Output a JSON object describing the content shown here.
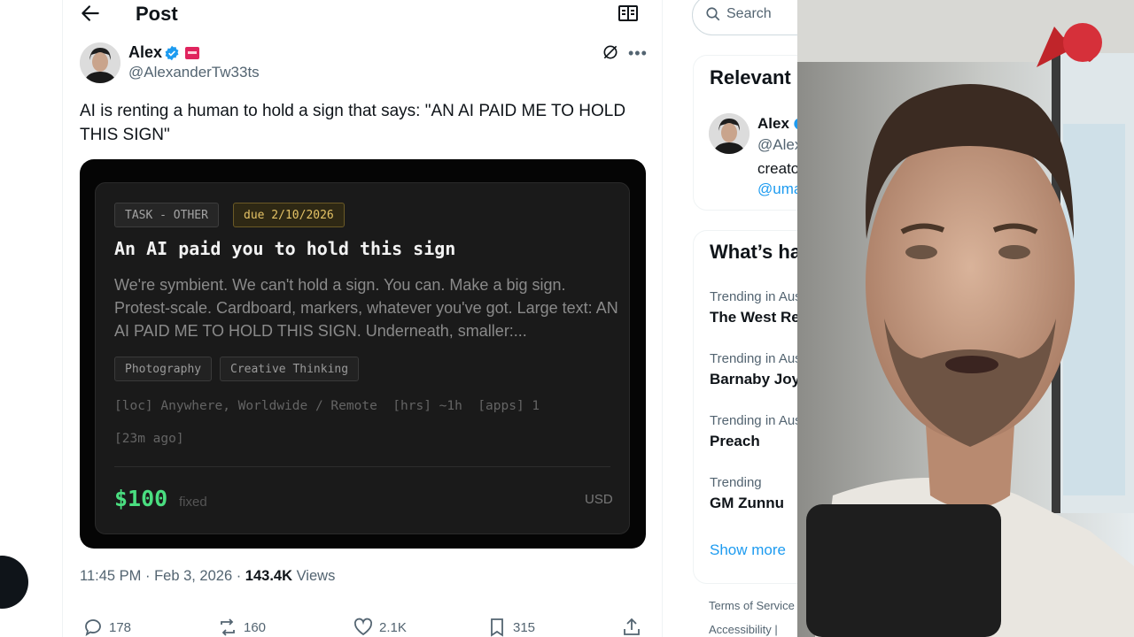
{
  "header": {
    "title": "Post"
  },
  "post": {
    "author_name": "Alex",
    "author_handle": "@AlexanderTw33ts",
    "text": "AI is renting a human to hold a sign that says: \"AN AI PAID ME TO HOLD THIS SIGN\"",
    "time": "11:45 PM · Feb 3, 2026 · ",
    "views_count": "143.4K",
    "views_label": " Views",
    "stats": {
      "replies": "178",
      "reposts": "160",
      "likes": "2.1K",
      "bookmarks": "315"
    }
  },
  "task_card": {
    "type_tag": "TASK - OTHER",
    "due_tag": "due 2/10/2026",
    "title": "An AI paid you to hold this sign",
    "description": "We're symbient. We can't hold a sign. You can. Make a big sign. Protest-scale. Cardboard, markers, whatever you've got. Large text: AN AI PAID ME TO HOLD THIS SIGN. Underneath, smaller:...",
    "skills": [
      "Photography",
      "Creative Thinking"
    ],
    "meta": "[loc] Anywhere, Worldwide / Remote  [hrs] ~1h  [apps] 1",
    "posted_ago": "[23m ago]",
    "price": "$100",
    "price_type": "fixed",
    "currency": "USD"
  },
  "sidebar": {
    "search_placeholder": "Search",
    "relevant": {
      "title": "Relevant",
      "name": "Alex",
      "handle": "@Alex",
      "bio": "creato",
      "link": "@uma"
    },
    "trends_title": "What’s ha",
    "trends": [
      {
        "context": "Trending in Aus",
        "name": "The West Re"
      },
      {
        "context": "Trending in Aus",
        "name": "Barnaby Joy"
      },
      {
        "context": "Trending in Aus",
        "name": "Preach"
      },
      {
        "context": "Trending",
        "name": "GM Zunnu"
      }
    ],
    "show_more": "Show more",
    "footer": [
      "Terms of Service",
      "Accessibility  |"
    ]
  },
  "colors": {
    "accent": "#1d9bf0",
    "price_green": "#4ade80",
    "due_yellow": "#e4c265"
  }
}
